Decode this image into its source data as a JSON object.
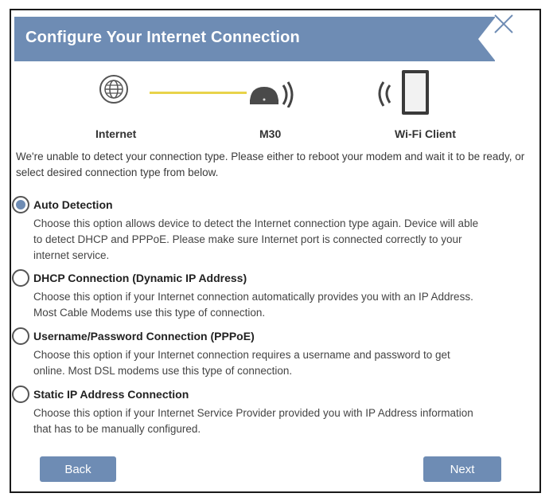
{
  "header": {
    "title": "Configure Your Internet Connection"
  },
  "diagram": {
    "internet_label": "Internet",
    "device_label": "M30",
    "client_label": "Wi-Fi Client"
  },
  "intro": "We're unable to detect your connection type. Please either to reboot your modem and wait it to be ready, or select desired connection type from below.",
  "options": [
    {
      "title": "Auto Detection",
      "selected": true,
      "desc": "Choose this option allows device to detect the Internet connection type again. Device will able to detect DHCP and PPPoE. Please make sure Internet port is connected correctly to your internet service."
    },
    {
      "title": "DHCP Connection (Dynamic IP Address)",
      "selected": false,
      "desc": "Choose this option if your Internet connection automatically provides you with an IP Address. Most Cable Modems use this type of connection."
    },
    {
      "title": "Username/Password Connection (PPPoE)",
      "selected": false,
      "desc": "Choose this option if your Internet connection requires a username and password to get online. Most DSL modems use this type of connection."
    },
    {
      "title": "Static IP Address Connection",
      "selected": false,
      "desc": "Choose this option if your Internet Service Provider provided you with IP Address information that has to be manually configured."
    }
  ],
  "buttons": {
    "back": "Back",
    "next": "Next"
  },
  "colors": {
    "header_bg": "#6e8cb4",
    "link_line": "#e8d34a"
  }
}
